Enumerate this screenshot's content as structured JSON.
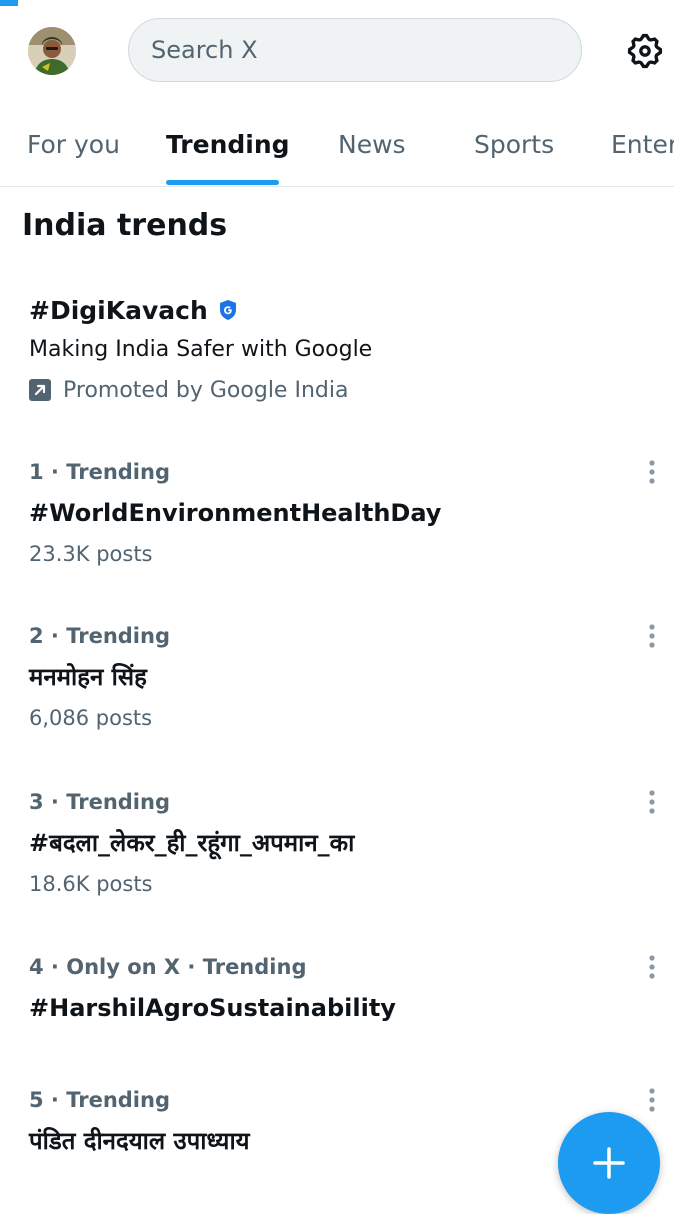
{
  "header": {
    "avatar_icon": "user-avatar",
    "search": {
      "placeholder": "Search X",
      "value": ""
    },
    "settings_icon": "gear-icon"
  },
  "tabs": [
    {
      "label": "For you",
      "active": false
    },
    {
      "label": "Trending",
      "active": true
    },
    {
      "label": "News",
      "active": false
    },
    {
      "label": "Sports",
      "active": false
    },
    {
      "label": "Enter",
      "active": false
    }
  ],
  "section": {
    "title": "India trends"
  },
  "promoted": {
    "hashtag": "#DigiKavach",
    "badge_icon": "google-verified-badge",
    "description": "Making India Safer with Google",
    "promoted_by": "Promoted by Google India"
  },
  "trends": [
    {
      "meta": "1 · Trending",
      "name": "#WorldEnvironmentHealthDay",
      "posts": "23.3K posts"
    },
    {
      "meta": "2 · Trending",
      "name": "मनमोहन सिंह",
      "posts": "6,086 posts"
    },
    {
      "meta": "3 · Trending",
      "name": "#बदला_लेकर_ही_रहूंगा_अपमान_का",
      "posts": "18.6K posts"
    },
    {
      "meta": "4 · Only on X · Trending",
      "name": "#HarshilAgroSustainability",
      "posts": ""
    },
    {
      "meta": "5 · Trending",
      "name": "पंडित दीनदयाल उपाध्याय",
      "posts": ""
    }
  ],
  "colors": {
    "accent": "#1d9bf0",
    "text_primary": "#0f1419",
    "text_secondary": "#536471",
    "search_bg": "#eff3f4"
  },
  "fab": {
    "icon": "plus-icon"
  }
}
